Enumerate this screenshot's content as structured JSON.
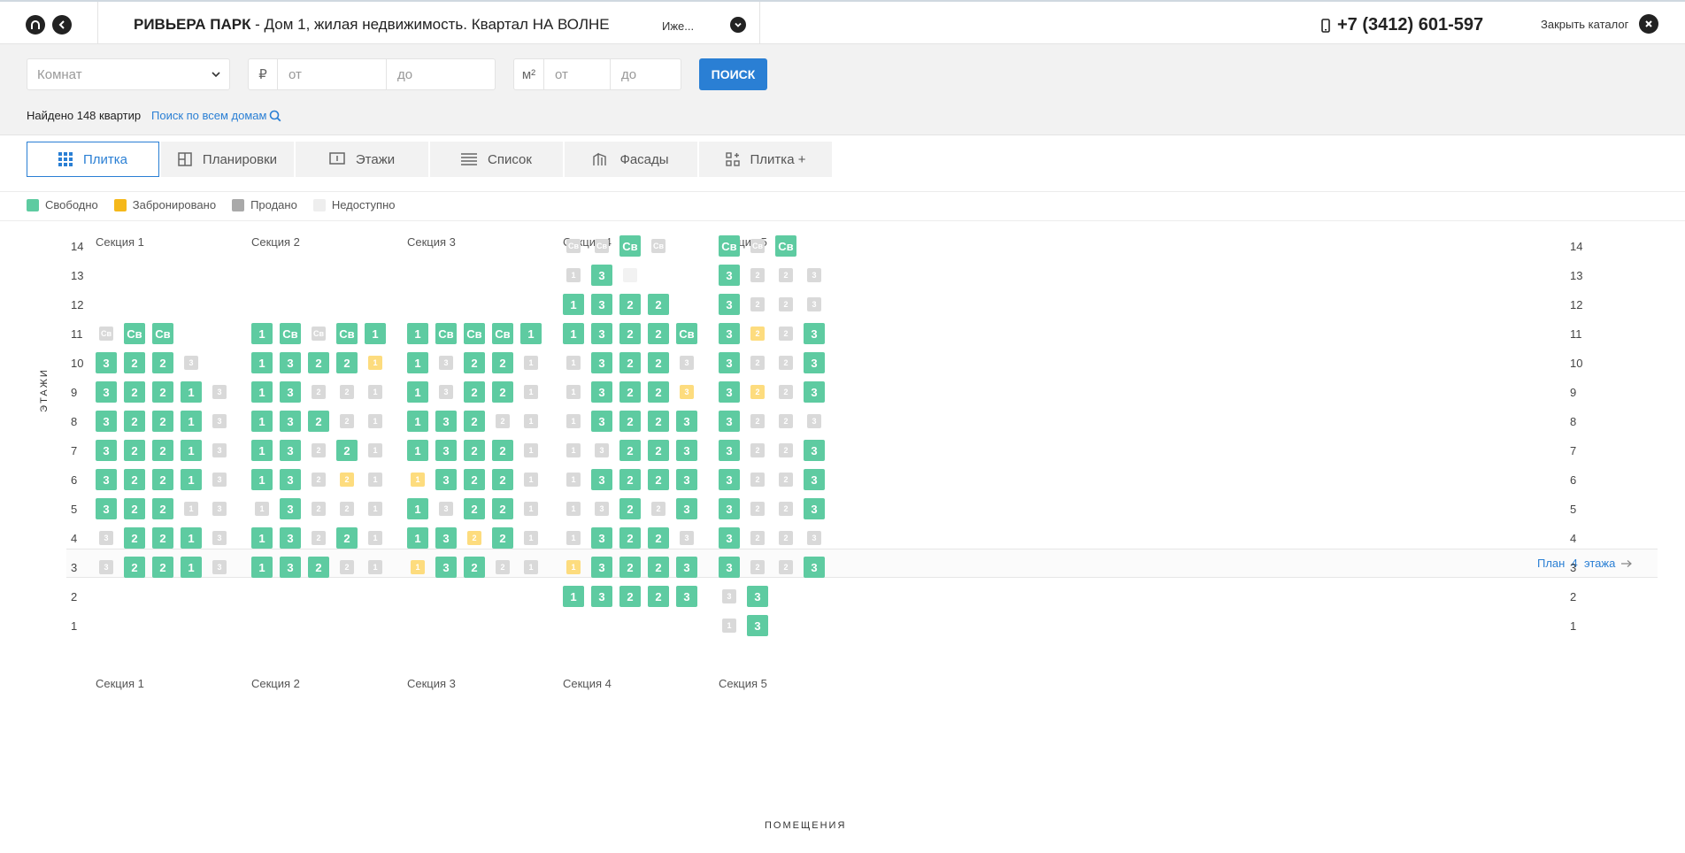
{
  "header": {
    "title_bold": "РИВЬЕРА ПАРК",
    "title_rest": " - Дом 1, жилая недвижимость. Квартал НА ВОЛНЕ",
    "more_label": "Иже...",
    "phone": "+7 (3412) 601-597",
    "close_label": "Закрыть каталог"
  },
  "filters": {
    "rooms_placeholder": "Комнат",
    "price_unit": "₽",
    "price_from_placeholder": "от",
    "price_to_placeholder": "до",
    "area_unit": "м²",
    "area_from_placeholder": "от",
    "area_to_placeholder": "до",
    "search_label": "ПОИСК",
    "found_text": "Найдено 148 квартир",
    "search_all_label": "Поиск по всем домам"
  },
  "tabs": [
    {
      "label": "Плитка",
      "icon": "grid-icon",
      "active": true
    },
    {
      "label": "Планировки",
      "icon": "floorplan-icon",
      "active": false
    },
    {
      "label": "Этажи",
      "icon": "floors-icon",
      "active": false
    },
    {
      "label": "Список",
      "icon": "list-icon",
      "active": false
    },
    {
      "label": "Фасады",
      "icon": "facade-icon",
      "active": false
    },
    {
      "label": "Плитка +",
      "icon": "grid-plus-icon",
      "active": false
    }
  ],
  "legend": [
    {
      "label": "Свободно",
      "color": "#5ecba1"
    },
    {
      "label": "Забронировано",
      "color": "#f5b81a"
    },
    {
      "label": "Продано",
      "color": "#a9a9a9"
    },
    {
      "label": "Недоступно",
      "color": "#eeeeee"
    }
  ],
  "colors": {
    "free": "#5ecba1",
    "booked": "#fddc7e",
    "sold": "#d9d9d9",
    "unavailable": "#f2f2f2",
    "accent": "#2a7fd4"
  },
  "board": {
    "axis_label": "ЭТАЖИ",
    "bottom_label": "ПОМЕЩЕНИЯ",
    "plan_link": "План  4  этажа",
    "floors": [
      14,
      13,
      12,
      11,
      10,
      9,
      8,
      7,
      6,
      5,
      4,
      3,
      2,
      1
    ],
    "sections": [
      {
        "name": "Секция 1",
        "rows": {
          "11": [
            "Св:s",
            "Св:f",
            "Св:f"
          ],
          "10": [
            "3:f",
            "2:f",
            "2:f",
            "3:s"
          ],
          "9": [
            "3:f",
            "2:f",
            "2:f",
            "1:f",
            "3:s"
          ],
          "8": [
            "3:f",
            "2:f",
            "2:f",
            "1:f",
            "3:s"
          ],
          "7": [
            "3:f",
            "2:f",
            "2:f",
            "1:f",
            "3:s"
          ],
          "6": [
            "3:f",
            "2:f",
            "2:f",
            "1:f",
            "3:s"
          ],
          "5": [
            "3:f",
            "2:f",
            "2:f",
            "1:s",
            "3:s"
          ],
          "4": [
            "3:s",
            "2:f",
            "2:f",
            "1:f",
            "3:s"
          ],
          "3": [
            "3:s",
            "2:f",
            "2:f",
            "1:f",
            "3:s"
          ]
        }
      },
      {
        "name": "Секция 2",
        "rows": {
          "11": [
            "1:f",
            "Св:f",
            "Св:s",
            "Св:f",
            "1:f"
          ],
          "10": [
            "1:f",
            "3:f",
            "2:f",
            "2:f",
            "1:b"
          ],
          "9": [
            "1:f",
            "3:f",
            "2:s",
            "2:s",
            "1:s"
          ],
          "8": [
            "1:f",
            "3:f",
            "2:f",
            "2:s",
            "1:s"
          ],
          "7": [
            "1:f",
            "3:f",
            "2:s",
            "2:f",
            "1:s"
          ],
          "6": [
            "1:f",
            "3:f",
            "2:s",
            "2:b",
            "1:s"
          ],
          "5": [
            "1:s",
            "3:f",
            "2:s",
            "2:s",
            "1:s"
          ],
          "4": [
            "1:f",
            "3:f",
            "2:s",
            "2:f",
            "1:s"
          ],
          "3": [
            "1:f",
            "3:f",
            "2:f",
            "2:s",
            "1:s"
          ]
        }
      },
      {
        "name": "Секция 3",
        "rows": {
          "11": [
            "1:f",
            "Св:f",
            "Св:f",
            "Св:f",
            "1:f"
          ],
          "10": [
            "1:f",
            "3:s",
            "2:f",
            "2:f",
            "1:s"
          ],
          "9": [
            "1:f",
            "3:s",
            "2:f",
            "2:f",
            "1:s"
          ],
          "8": [
            "1:f",
            "3:f",
            "2:f",
            "2:s",
            "1:s"
          ],
          "7": [
            "1:f",
            "3:f",
            "2:f",
            "2:f",
            "1:s"
          ],
          "6": [
            "1:b",
            "3:f",
            "2:f",
            "2:f",
            "1:s"
          ],
          "5": [
            "1:f",
            "3:s",
            "2:f",
            "2:f",
            "1:s"
          ],
          "4": [
            "1:f",
            "3:f",
            "2:b",
            "2:f",
            "1:s"
          ],
          "3": [
            "1:b",
            "3:f",
            "2:f",
            "2:s",
            "1:s"
          ]
        }
      },
      {
        "name": "Секция 4",
        "rows": {
          "14": [
            "Св:s",
            "Св:s",
            "Св:f",
            "Св:s"
          ],
          "13": [
            "1:s",
            "3:f",
            ":u"
          ],
          "12": [
            "1:f",
            "3:f",
            "2:f",
            "2:f"
          ],
          "11": [
            "1:f",
            "3:f",
            "2:f",
            "2:f",
            "Св:f"
          ],
          "10": [
            "1:s",
            "3:f",
            "2:f",
            "2:f",
            "3:s"
          ],
          "9": [
            "1:s",
            "3:f",
            "2:f",
            "2:f",
            "3:b"
          ],
          "8": [
            "1:s",
            "3:f",
            "2:f",
            "2:f",
            "3:f"
          ],
          "7": [
            "1:s",
            "3:s",
            "2:f",
            "2:f",
            "3:f"
          ],
          "6": [
            "1:s",
            "3:f",
            "2:f",
            "2:f",
            "3:f"
          ],
          "5": [
            "1:s",
            "3:s",
            "2:f",
            "2:s",
            "3:f"
          ],
          "4": [
            "1:s",
            "3:f",
            "2:f",
            "2:f",
            "3:s"
          ],
          "3": [
            "1:b",
            "3:f",
            "2:f",
            "2:f",
            "3:f"
          ],
          "2": [
            "1:f",
            "3:f",
            "2:f",
            "2:f",
            "3:f"
          ]
        }
      },
      {
        "name": "Секция 5",
        "rows": {
          "14": [
            "Св:f",
            "Св:s",
            "Св:f"
          ],
          "13": [
            "3:f",
            "2:s",
            "2:s",
            "3:s"
          ],
          "12": [
            "3:f",
            "2:s",
            "2:s",
            "3:s"
          ],
          "11": [
            "3:f",
            "2:b",
            "2:s",
            "3:f"
          ],
          "10": [
            "3:f",
            "2:s",
            "2:s",
            "3:f"
          ],
          "9": [
            "3:f",
            "2:b",
            "2:s",
            "3:f"
          ],
          "8": [
            "3:f",
            "2:s",
            "2:s",
            "3:s"
          ],
          "7": [
            "3:f",
            "2:s",
            "2:s",
            "3:f"
          ],
          "6": [
            "3:f",
            "2:s",
            "2:s",
            "3:f"
          ],
          "5": [
            "3:f",
            "2:s",
            "2:s",
            "3:f"
          ],
          "4": [
            "3:f",
            "2:s",
            "2:s",
            "3:s"
          ],
          "3": [
            "3:f",
            "2:s",
            "2:s",
            "3:f"
          ],
          "2": [
            "3:s",
            "3:f"
          ],
          "1": [
            "1:s",
            "3:f"
          ]
        }
      }
    ]
  }
}
